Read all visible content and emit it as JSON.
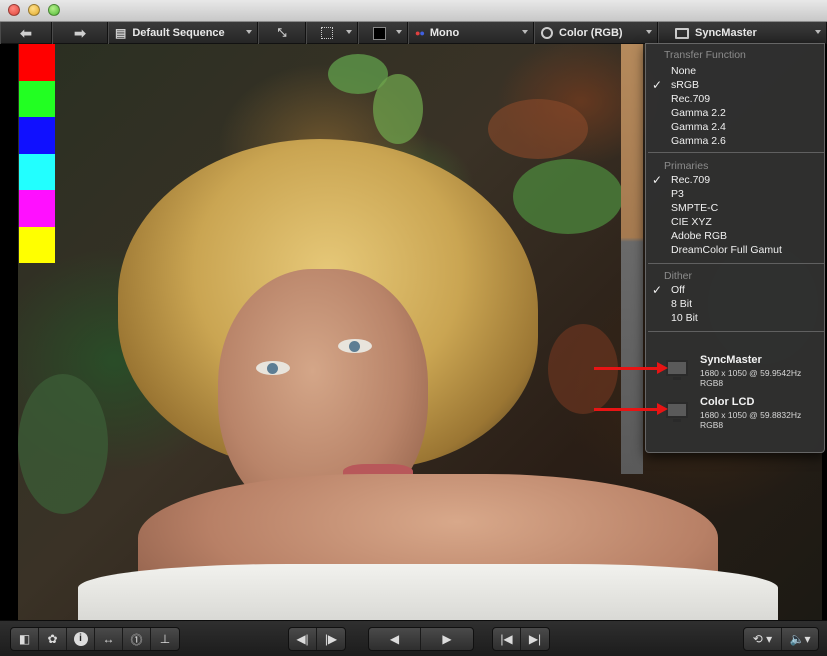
{
  "window": {
    "traffic_lights": [
      "close",
      "minimize",
      "zoom"
    ]
  },
  "toolbar": {
    "back_icon": "arrow-left-icon",
    "forward_icon": "arrow-right-icon",
    "sequence_label": "Default Sequence",
    "mono_label": "Mono",
    "color_label": "Color (RGB)",
    "display_label": "SyncMaster"
  },
  "swatches": [
    "#ff0000",
    "#22ff22",
    "#1010ff",
    "#22ffff",
    "#ff10ff",
    "#ffff00"
  ],
  "menu": {
    "transfer_header": "Transfer Function",
    "transfer_items": [
      "None",
      "sRGB",
      "Rec.709",
      "Gamma 2.2",
      "Gamma 2.4",
      "Gamma 2.6"
    ],
    "transfer_checked": "sRGB",
    "primaries_header": "Primaries",
    "primaries_items": [
      "Rec.709",
      "P3",
      "SMPTE-C",
      "CIE XYZ",
      "Adobe RGB",
      "DreamColor Full Gamut"
    ],
    "primaries_checked": "Rec.709",
    "dither_header": "Dither",
    "dither_items": [
      "Off",
      "8 Bit",
      "10 Bit"
    ],
    "dither_checked": "Off",
    "check_glyph": "✓",
    "displays": [
      {
        "name": "SyncMaster",
        "resolution": "1680 x 1050 @ 59.9542Hz",
        "format": "RGB8"
      },
      {
        "name": "Color LCD",
        "resolution": "1680 x 1050 @ 59.8832Hz",
        "format": "RGB8"
      }
    ]
  },
  "bottombar": {
    "left_icons": [
      "panel-icon",
      "color-wheel-icon",
      "info-icon",
      "swap-icon",
      "timecode-icon",
      "baseline-icon"
    ],
    "frame_icons": [
      "step-back-icon",
      "step-forward-icon"
    ],
    "play_icons": [
      "play-reverse-icon",
      "play-icon"
    ],
    "jump_icons": [
      "jump-start-icon",
      "jump-end-icon"
    ],
    "right_icons": [
      "loop-icon",
      "volume-icon"
    ]
  },
  "colors": {
    "annotation_arrow": "#e81414",
    "menu_bg": "#303030"
  }
}
